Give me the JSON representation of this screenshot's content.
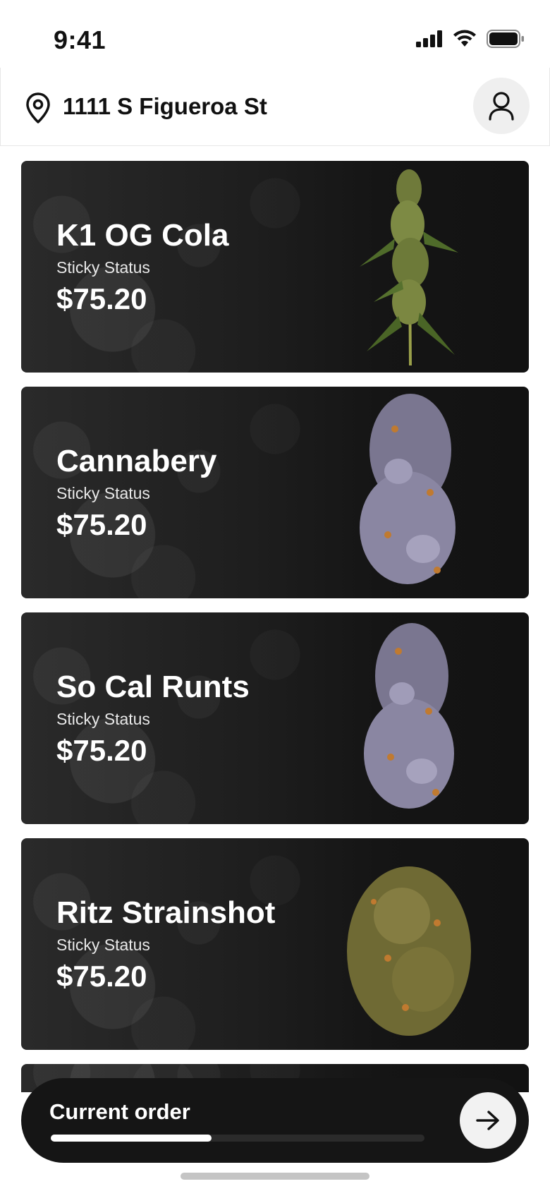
{
  "status_bar": {
    "time": "9:41"
  },
  "header": {
    "address": "1111 S Figueroa St"
  },
  "products": [
    {
      "name": "K1 OG Cola",
      "subtitle": "Sticky Status",
      "price": "$75.20",
      "image": "tall-cola-bud"
    },
    {
      "name": "Cannabery",
      "subtitle": "Sticky Status",
      "price": "$75.20",
      "image": "purple-bud"
    },
    {
      "name": "So Cal Runts",
      "subtitle": "Sticky Status",
      "price": "$75.20",
      "image": "purple-bud"
    },
    {
      "name": "Ritz Strainshot",
      "subtitle": "Sticky Status",
      "price": "$75.20",
      "image": "green-bud"
    }
  ],
  "current_order": {
    "label": "Current order",
    "progress": 0.43
  },
  "icons": [
    "signal-icon",
    "wifi-icon",
    "battery-icon",
    "location-pin-icon",
    "user-icon",
    "arrow-right-icon"
  ]
}
